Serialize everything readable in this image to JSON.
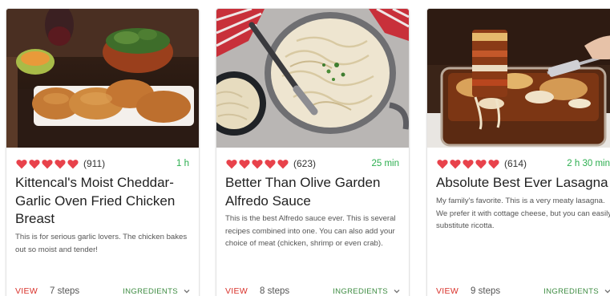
{
  "colors": {
    "heart": "#e8424b",
    "time": "#2cae4f",
    "view": "#d9322b",
    "ingredients": "#3f8d43"
  },
  "cards": [
    {
      "image": "fried-chicken-photo",
      "rating_count": "(911)",
      "time": "1 h",
      "title": "Kittencal's Moist Cheddar-Garlic Oven Fried Chicken Breast",
      "description": "This is for serious garlic lovers. The chicken bakes out so moist and tender!",
      "view_label": "VIEW",
      "steps": "7 steps",
      "ingredients_label": "INGREDIENTS"
    },
    {
      "image": "alfredo-sauce-photo",
      "rating_count": "(623)",
      "time": "25 min",
      "title": "Better Than Olive Garden Alfredo Sauce",
      "description": "This is the best Alfredo sauce ever. This is several recipes combined into one. You can also add your choice of meat (chicken, shrimp or even crab).",
      "view_label": "VIEW",
      "steps": "8 steps",
      "ingredients_label": "INGREDIENTS"
    },
    {
      "image": "lasagna-photo",
      "rating_count": "(614)",
      "time": "2 h 30 min",
      "title": "Absolute Best Ever Lasagna",
      "description": "My family's favorite. This is a very meaty lasagna. We prefer it with cottage cheese, but you can easily substitute ricotta.",
      "view_label": "VIEW",
      "steps": "9 steps",
      "ingredients_label": "INGREDIENTS"
    }
  ]
}
